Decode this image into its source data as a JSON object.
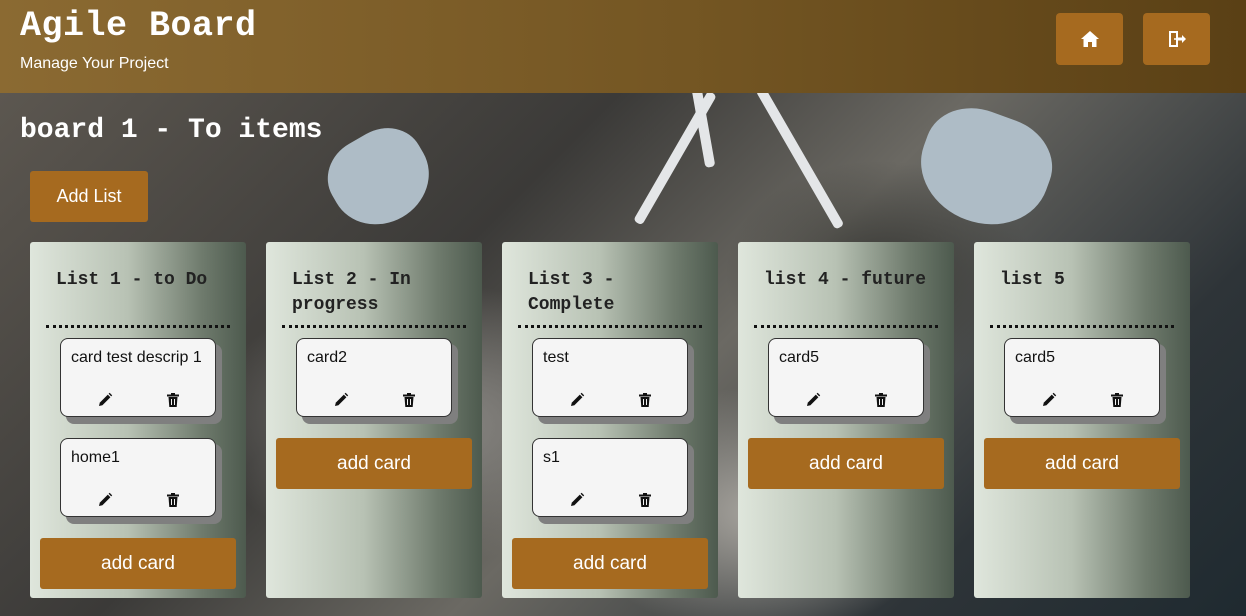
{
  "header": {
    "title": "Agile Board",
    "subtitle": "Manage Your Project",
    "home_icon": "home-icon",
    "logout_icon": "logout-icon"
  },
  "board": {
    "title": "board 1 - To items",
    "add_list_label": "Add List"
  },
  "lists": [
    {
      "title": "List 1 - to Do",
      "cards": [
        "card test descrip 1",
        "home1"
      ],
      "add_card_label": "add card"
    },
    {
      "title": "List 2 - In progress",
      "cards": [
        "card2"
      ],
      "add_card_label": "add card"
    },
    {
      "title": "List 3 - Complete",
      "cards": [
        "test",
        "s1"
      ],
      "add_card_label": "add card"
    },
    {
      "title": "list 4 - future",
      "cards": [
        "card5"
      ],
      "add_card_label": "add card"
    },
    {
      "title": "list 5",
      "cards": [
        "card5"
      ],
      "add_card_label": "add card"
    }
  ],
  "colors": {
    "accent": "#a66a1f",
    "header_start": "#8b6a32",
    "header_end": "#5a4015",
    "card_bg": "#f5f5f5"
  }
}
